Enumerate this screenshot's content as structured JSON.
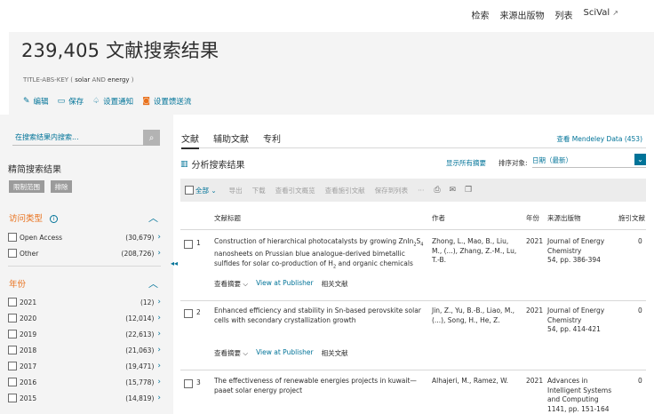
{
  "topnav": {
    "search": "检索",
    "sources": "来源出版物",
    "lists": "列表",
    "scival": "SciVal",
    "ext_icon": "↗"
  },
  "header": {
    "title": "239,405 文献搜索结果",
    "query_prefix": "TITLE-ABS-KEY (",
    "query_t1": "solar",
    "query_op": "AND",
    "query_t2": "energy",
    "query_suffix": ")",
    "actions": [
      {
        "label": "编辑",
        "icon": "pencil-icon"
      },
      {
        "label": "保存",
        "icon": "save-icon"
      },
      {
        "label": "设置通知",
        "icon": "bell-icon"
      },
      {
        "label": "设置馈送流",
        "icon": "rss-icon"
      }
    ]
  },
  "sidebar": {
    "search_placeholder": "在搜索结果内搜索...",
    "refine_title": "精简搜索结果",
    "limit_label": "限制范围",
    "exclude_label": "排除",
    "access_title": "访问类型",
    "access_items": [
      {
        "label": "Open Access",
        "count": "(30,679)"
      },
      {
        "label": "Other",
        "count": "(208,726)"
      }
    ],
    "year_title": "年份",
    "year_items": [
      {
        "label": "2021",
        "count": "(12)"
      },
      {
        "label": "2020",
        "count": "(12,014)"
      },
      {
        "label": "2019",
        "count": "(22,613)"
      },
      {
        "label": "2018",
        "count": "(21,063)"
      },
      {
        "label": "2017",
        "count": "(19,471)"
      },
      {
        "label": "2016",
        "count": "(15,778)"
      },
      {
        "label": "2015",
        "count": "(14,819)"
      }
    ]
  },
  "tabs": [
    "文献",
    "辅助文献",
    "专利"
  ],
  "mendeley": "查看 Mendeley Data (453)",
  "analyze": "分析搜索结果",
  "show_abstracts": "显示所有摘要",
  "sort": {
    "label": "排序对象:",
    "value": "日期（最新）"
  },
  "toolbar": {
    "all": "全部",
    "items": [
      "导出",
      "下载",
      "查看引文概览",
      "查看施引文献",
      "保存到列表"
    ],
    "more": "···"
  },
  "columns": {
    "title": "文献标题",
    "authors": "作者",
    "year": "年份",
    "source": "来源出版物",
    "cited": "施引文献"
  },
  "rows": [
    {
      "num": "1",
      "title_a": "Construction of hierarchical photocatalysts by growing ZnIn",
      "title_s1": "2",
      "title_b": "S",
      "title_s2": "4",
      "title_c": " nanosheets on Prussian blue analogue-derived bimetallic sulfides for solar co-production of H",
      "title_s3": "2",
      "title_d": " and organic chemicals",
      "authors": "Zhong, L., Mao, B., Liu, M., (...), Zhang, Z.-M., Lu, T.-B.",
      "year": "2021",
      "source": "Journal of Energy Chemistry",
      "pages": "54, pp. 386-394",
      "cited": "0",
      "view_abstract": "查看摘要 ⌵",
      "publisher": "View at Publisher",
      "related": "相关文献"
    },
    {
      "num": "2",
      "title": "Enhanced efficiency and stability in Sn-based perovskite solar cells with secondary crystallization growth",
      "authors": "Jin, Z., Yu, B.-B., Liao, M., (...), Song, H., He, Z.",
      "year": "2021",
      "source": "Journal of Energy Chemistry",
      "pages": "54, pp. 414-421",
      "cited": "0",
      "view_abstract": "查看摘要 ⌵",
      "publisher": "View at Publisher",
      "related": "相关文献"
    },
    {
      "num": "3",
      "title": "The effectiveness of renewable energies projects in kuwait—paaet solar energy project",
      "authors": "Alhajeri, M., Ramez, W.",
      "year": "2021",
      "source": "Advances in Intelligent Systems and Computing",
      "pages": "1141, pp. 151-164",
      "cited": "0"
    }
  ]
}
